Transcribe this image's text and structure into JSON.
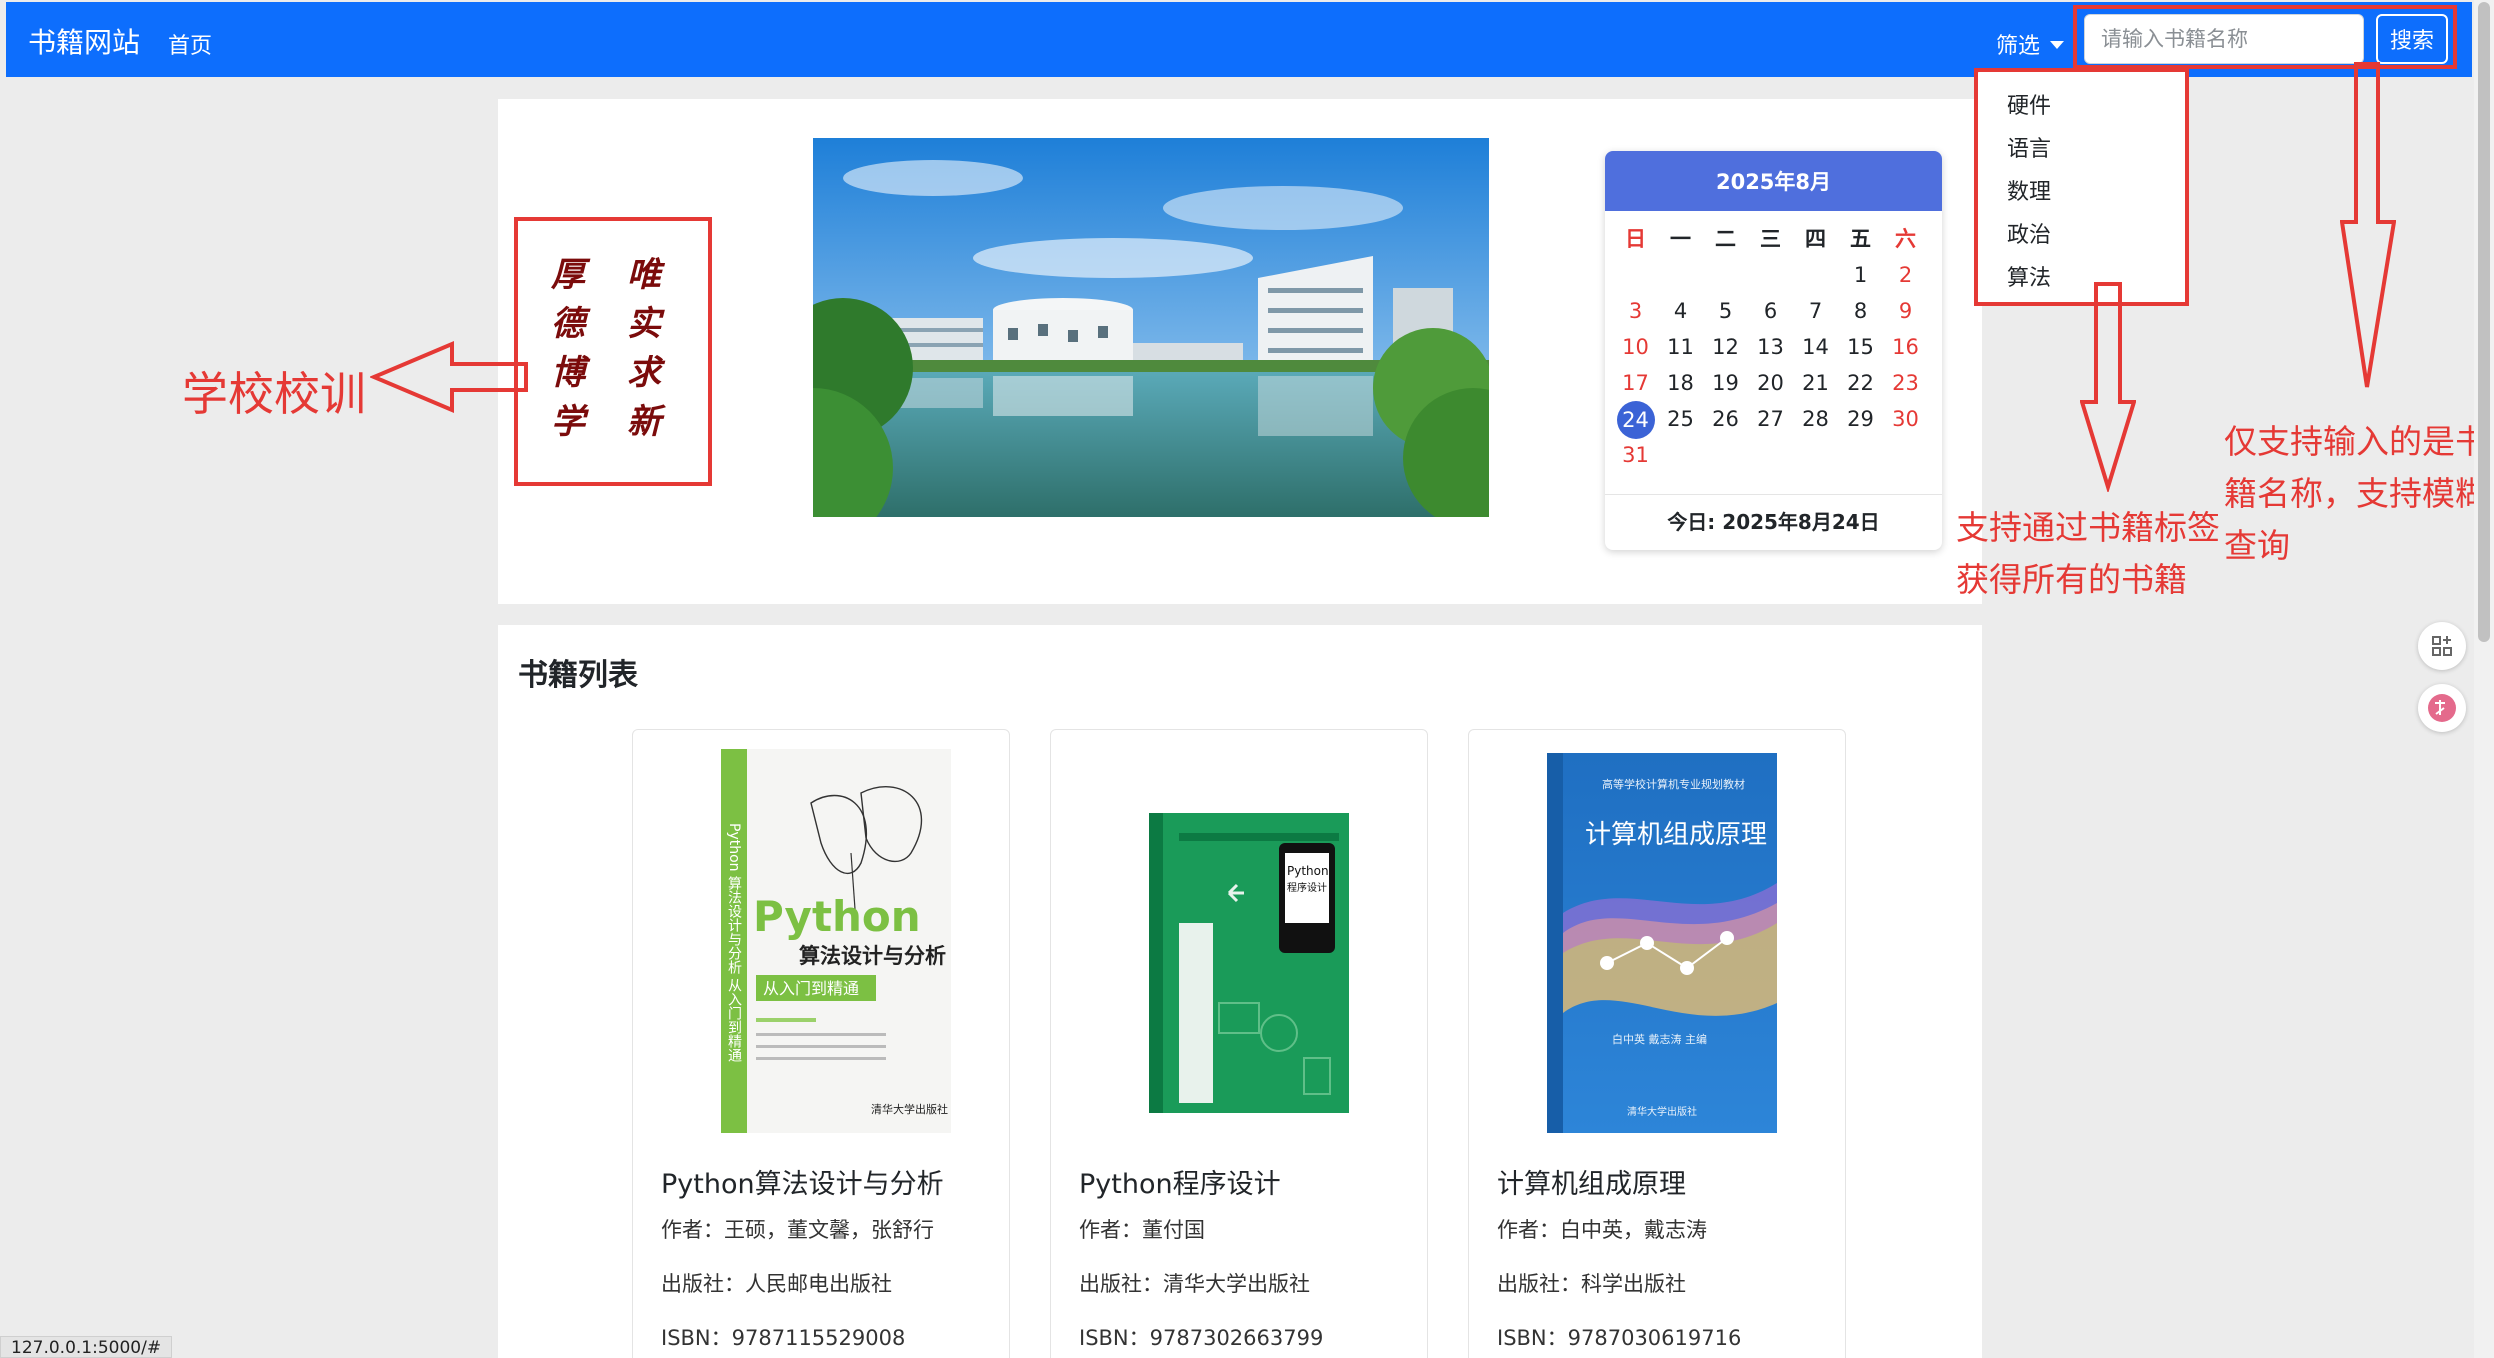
{
  "navbar": {
    "brand": "书籍网站",
    "home": "首页",
    "filter": "筛选",
    "search_placeholder": "请输入书籍名称",
    "search_button": "搜索"
  },
  "filter_menu": [
    "硬件",
    "语言",
    "数理",
    "政治",
    "算法"
  ],
  "motto": [
    "厚",
    "德",
    "博",
    "学",
    "唯",
    "实",
    "求",
    "新"
  ],
  "calendar": {
    "title": "2025年8月",
    "weekdays": [
      "日",
      "一",
      "二",
      "三",
      "四",
      "五",
      "六"
    ],
    "weeks": [
      [
        "",
        "",
        "",
        "",
        "",
        "1",
        "2"
      ],
      [
        "3",
        "4",
        "5",
        "6",
        "7",
        "8",
        "9"
      ],
      [
        "10",
        "11",
        "12",
        "13",
        "14",
        "15",
        "16"
      ],
      [
        "17",
        "18",
        "19",
        "20",
        "21",
        "22",
        "23"
      ],
      [
        "24",
        "25",
        "26",
        "27",
        "28",
        "29",
        "30"
      ],
      [
        "31",
        "",
        "",
        "",
        "",
        "",
        ""
      ]
    ],
    "today_day": "24",
    "today_label": "今日: 2025年8月24日"
  },
  "book_list": {
    "title": "书籍列表",
    "books": [
      {
        "title": "Python算法设计与分析",
        "author": "作者：王硕，董文馨，张舒行",
        "publisher": "出版社：人民邮电出版社",
        "isbn": "ISBN：9787115529008",
        "cover": {
          "main": "Python",
          "sub": "算法设计与分析",
          "band": "从入门到精通",
          "spine": "Python 算法设计与分析 从入门到精通",
          "publisher": "清华大学出版社",
          "colors": [
            "#7cc043",
            "#f7f7f7"
          ]
        }
      },
      {
        "title": "Python程序设计",
        "author": "作者：董付国",
        "publisher": "出版社：清华大学出版社",
        "isbn": "ISBN：9787302663799",
        "cover": {
          "main": "Python",
          "sub": "程序设计",
          "colors": [
            "#1a9b59",
            "#0c7a43"
          ]
        }
      },
      {
        "title": "计算机组成原理",
        "author": "作者：白中英，戴志涛",
        "publisher": "出版社：科学出版社",
        "isbn": "ISBN：9787030619716",
        "cover": {
          "top": "高等学校计算机专业规划教材",
          "main": "计算机组成原理",
          "authors": "白中英 戴志涛 主编",
          "publisher": "清华大学出版社",
          "colors": [
            "#1f6fc2",
            "#2d85d8"
          ]
        }
      }
    ]
  },
  "annotations": {
    "motto": "学校校训",
    "filter": [
      "支持通过书籍标签",
      "获得所有的书籍"
    ],
    "search": [
      "仅支持输入的是书",
      "籍名称，支持模糊",
      "查询"
    ]
  },
  "status_url": "127.0.0.1:5000/#",
  "colors": {
    "primary": "#0d6efd",
    "annotation": "#e53935",
    "calendar_header": "#4f6fdd"
  }
}
